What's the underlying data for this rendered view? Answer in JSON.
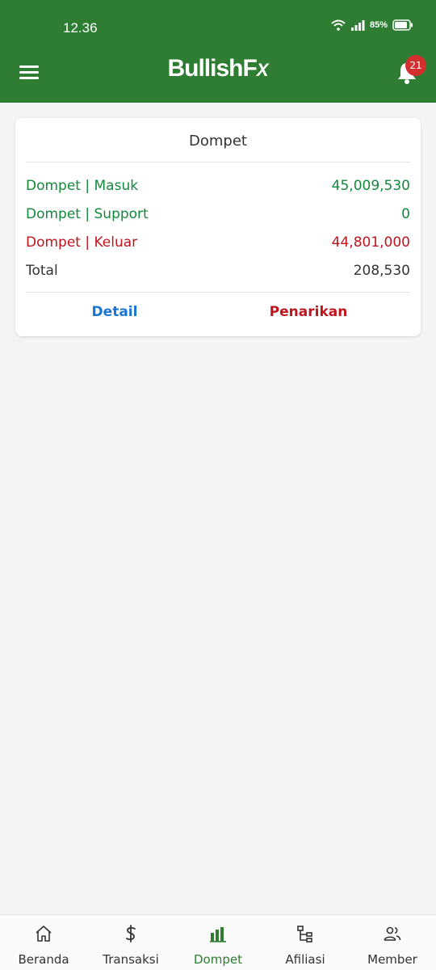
{
  "status_bar": {
    "time": "12.36",
    "battery": "85%"
  },
  "app_bar": {
    "brand_main": "BullishF",
    "brand_fx": "X",
    "notification_count": "21"
  },
  "wallet": {
    "title": "Dompet",
    "rows": [
      {
        "label": "Dompet | Masuk",
        "value": "45,009,530",
        "color": "#12893b"
      },
      {
        "label": "Dompet | Support",
        "value": "0",
        "color": "#12893b"
      },
      {
        "label": "Dompet | Keluar",
        "value": "44,801,000",
        "color": "#c0141d"
      },
      {
        "label": "Total",
        "value": "208,530",
        "color": "#333333"
      }
    ],
    "detail_label": "Detail",
    "withdraw_label": "Penarikan"
  },
  "nav": {
    "items": [
      {
        "label": "Beranda",
        "icon": "home-icon"
      },
      {
        "label": "Transaksi",
        "icon": "dollar-icon"
      },
      {
        "label": "Dompet",
        "icon": "bar-chart-icon",
        "active": true
      },
      {
        "label": "Afiliasi",
        "icon": "network-icon"
      },
      {
        "label": "Member",
        "icon": "users-icon"
      }
    ]
  },
  "colors": {
    "primary": "#2e7d32",
    "income": "#12893b",
    "expense": "#c0141d",
    "link": "#1976d2"
  }
}
